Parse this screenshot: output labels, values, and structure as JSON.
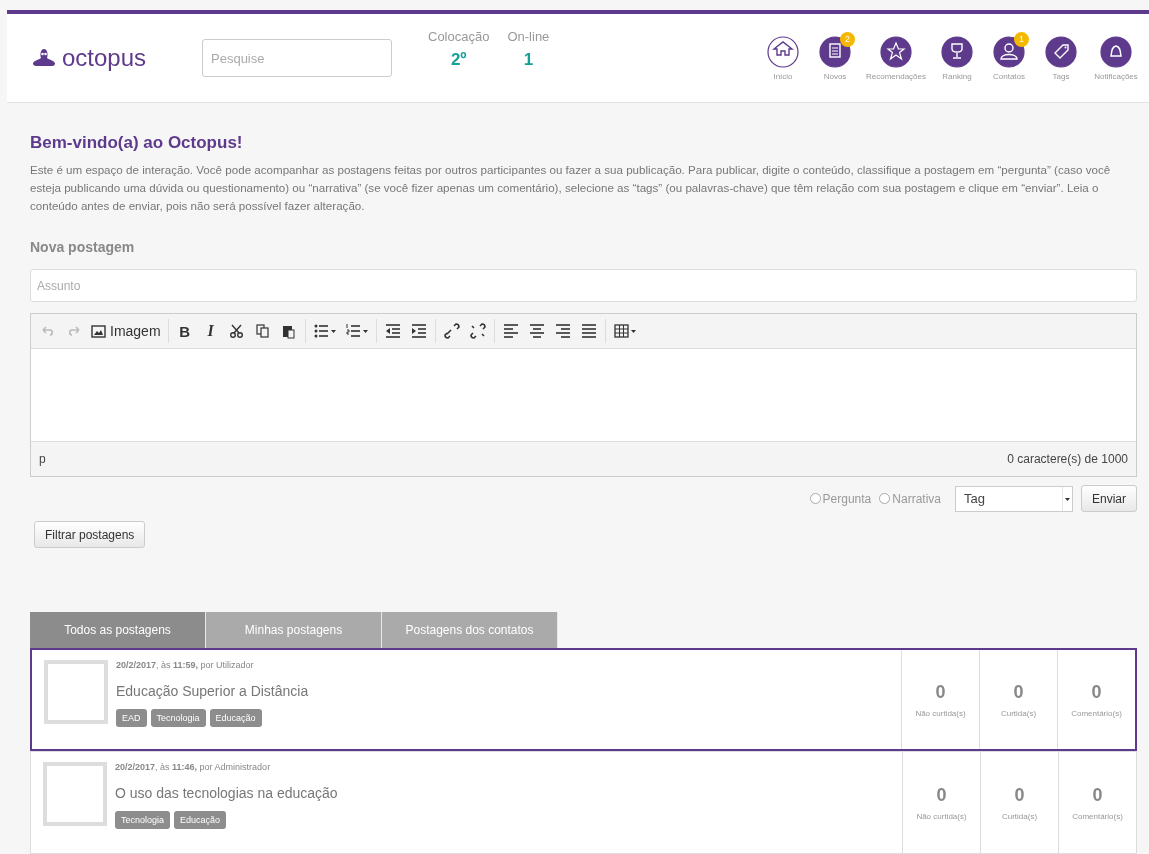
{
  "header": {
    "logo": "octopus",
    "search": {
      "placeholder": "Pesquise"
    },
    "stats": [
      {
        "label": "Colocação",
        "value": "2º"
      },
      {
        "label": "On-line",
        "value": "1"
      }
    ],
    "nav": [
      {
        "kind": "home",
        "label": "Início",
        "selected": true
      },
      {
        "kind": "news",
        "label": "Novos",
        "selected": false,
        "badge": "2"
      },
      {
        "kind": "star",
        "label": "Recomendações",
        "selected": false
      },
      {
        "kind": "trophy",
        "label": "Ranking",
        "selected": false
      },
      {
        "kind": "person",
        "label": "Contatos",
        "selected": false,
        "badge": "1"
      },
      {
        "kind": "tag",
        "label": "Tags",
        "selected": false
      },
      {
        "kind": "bell",
        "label": "Notificações",
        "selected": false
      }
    ]
  },
  "welcome": {
    "title": "Bem-vindo(a) ao Octopus!",
    "text": "Este é um espaço de interação. Você pode acompanhar as postagens feitas por outros participantes ou fazer a sua publicação. Para publicar, digite o conteúdo, classifique a postagem em “pergunta” (caso você esteja publicando uma dúvida ou questionamento) ou “narrativa” (se você fizer apenas um comentário), selecione as “tags” (ou palavras-chave) que têm relação com sua postagem e clique em “enviar”. Leia o conteúdo antes de enviar, pois não será possível fazer alteração."
  },
  "new_post": {
    "heading": "Nova postagem",
    "subject": {
      "placeholder": "Assunto"
    },
    "toolbar": [
      {
        "kind": "undo",
        "disabled": true
      },
      {
        "kind": "redo",
        "disabled": true
      },
      {
        "kind": "image",
        "label": "Imagem",
        "disabled": false
      },
      {
        "kind": "sep"
      },
      {
        "kind": "bold",
        "label": "B",
        "disabled": false
      },
      {
        "kind": "italic",
        "label": "I",
        "disabled": false
      },
      {
        "kind": "cut",
        "disabled": false
      },
      {
        "kind": "copy",
        "disabled": false
      },
      {
        "kind": "paste",
        "disabled": false
      },
      {
        "kind": "sep"
      },
      {
        "kind": "bullets",
        "disabled": false
      },
      {
        "kind": "numbers",
        "disabled": false
      },
      {
        "kind": "sep"
      },
      {
        "kind": "outdent",
        "disabled": false
      },
      {
        "kind": "indent",
        "disabled": false
      },
      {
        "kind": "sep"
      },
      {
        "kind": "link",
        "disabled": false
      },
      {
        "kind": "unlink",
        "disabled": false
      },
      {
        "kind": "sep"
      },
      {
        "kind": "align-left",
        "disabled": false
      },
      {
        "kind": "align-center",
        "disabled": false
      },
      {
        "kind": "align-right",
        "disabled": false
      },
      {
        "kind": "justify",
        "disabled": false
      },
      {
        "kind": "sep"
      },
      {
        "kind": "table",
        "disabled": false
      }
    ],
    "path": "p",
    "counter": "0 caractere(s) de 1000",
    "types": [
      {
        "label": "Pergunta",
        "selected": false
      },
      {
        "label": "Narrativa",
        "selected": false
      }
    ],
    "tag_select": "Tag",
    "send": "Enviar"
  },
  "filter_button": "Filtrar postagens",
  "tabs": [
    {
      "label": "Todos as postagens",
      "selected": true
    },
    {
      "label": "Minhas postagens",
      "selected": false
    },
    {
      "label": "Postagens dos contatos",
      "selected": false
    }
  ],
  "posts": [
    {
      "selected": true,
      "meta": "**20/2/2017**, às **11:59,** por Utilizador",
      "title": "Educação Superior a Distância",
      "tags": [
        "EAD",
        "Tecnologia",
        "Educação"
      ],
      "counts": [
        {
          "value": "0",
          "label": "Não curtida(s)"
        },
        {
          "value": "0",
          "label": "Curtida(s)"
        },
        {
          "value": "0",
          "label": "Comentário(s)"
        }
      ]
    },
    {
      "selected": false,
      "meta": "**20/2/2017**, às **11:46,** por Administrador",
      "title": "O uso das tecnologias na educação",
      "tags": [
        "Tecnologia",
        "Educação"
      ],
      "counts": [
        {
          "value": "0",
          "label": "Não curtida(s)"
        },
        {
          "value": "0",
          "label": "Curtida(s)"
        },
        {
          "value": "0",
          "label": "Comentário(s)"
        }
      ]
    }
  ]
}
